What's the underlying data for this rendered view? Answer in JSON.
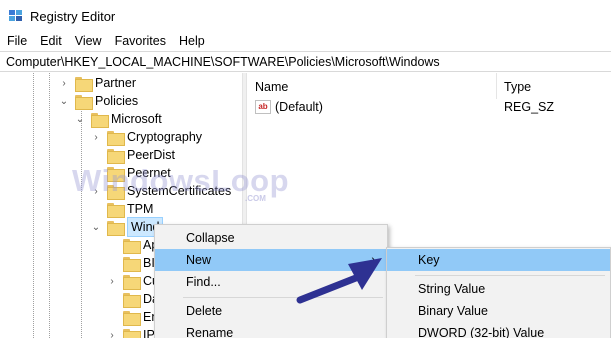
{
  "window": {
    "title": "Registry Editor",
    "icon": "registry-editor-icon"
  },
  "menubar": [
    "File",
    "Edit",
    "View",
    "Favorites",
    "Help"
  ],
  "address": "Computer\\HKEY_LOCAL_MACHINE\\SOFTWARE\\Policies\\Microsoft\\Windows",
  "tree": {
    "items": [
      {
        "label": "Partner",
        "chevron": "›"
      },
      {
        "label": "Policies",
        "chevron": "⌄"
      },
      {
        "label": "Microsoft",
        "chevron": "⌄"
      },
      {
        "label": "Cryptography",
        "chevron": "›"
      },
      {
        "label": "PeerDist",
        "chevron": ""
      },
      {
        "label": "Peernet",
        "chevron": ""
      },
      {
        "label": "SystemCertificates",
        "chevron": "›"
      },
      {
        "label": "TPM",
        "chevron": ""
      },
      {
        "label": "Wind",
        "chevron": "⌄"
      },
      {
        "label": "Ap",
        "chevron": ""
      },
      {
        "label": "BI",
        "chevron": ""
      },
      {
        "label": "Cu",
        "chevron": "›"
      },
      {
        "label": "Da",
        "chevron": ""
      },
      {
        "label": "En",
        "chevron": ""
      },
      {
        "label": "IP",
        "chevron": "›"
      }
    ]
  },
  "list": {
    "columns": {
      "name": "Name",
      "type": "Type"
    },
    "rows": [
      {
        "icon": "ab",
        "name": "(Default)",
        "type": "REG_SZ"
      }
    ]
  },
  "watermark": {
    "text": "WindowsLoop",
    "sub": ".COM"
  },
  "context_menu": {
    "items": [
      "Collapse",
      "New",
      "Find...",
      "Delete",
      "Rename"
    ],
    "new_arrow": "›"
  },
  "submenu": {
    "items": [
      "Key",
      "String Value",
      "Binary Value",
      "DWORD (32-bit) Value"
    ]
  },
  "colors": {
    "highlight": "#91c9f7",
    "selection": "#cce8ff",
    "annotation_arrow": "#2e3192"
  }
}
